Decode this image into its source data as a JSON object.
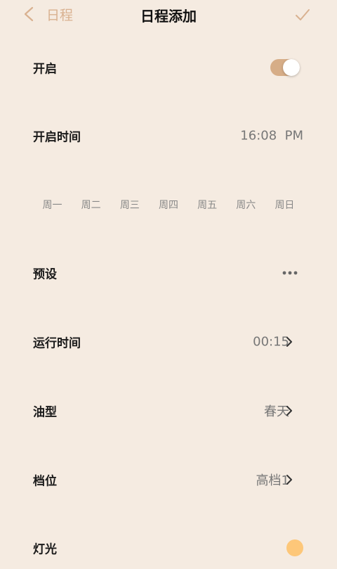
{
  "header": {
    "back_label": "日程",
    "title": "日程添加"
  },
  "rows": {
    "enable": {
      "label": "开启",
      "toggle_on": true
    },
    "start_time": {
      "label": "开启时间",
      "value": "16:08  PM"
    },
    "preset": {
      "label": "预设"
    },
    "run_time": {
      "label": "运行时间",
      "value": "00:15"
    },
    "oil_type": {
      "label": "油型",
      "value": "春天"
    },
    "gear": {
      "label": "档位",
      "value": "高档1"
    },
    "light": {
      "label": "灯光"
    }
  },
  "weekdays": [
    "周一",
    "周二",
    "周三",
    "周四",
    "周五",
    "周六",
    "周日"
  ],
  "colors": {
    "background": "#f5ebe1",
    "accent": "#d6ad87",
    "back_label": "#d9b190",
    "light_dot": "#fdc779"
  },
  "icons": {
    "back": "chevron-left-icon",
    "confirm": "checkmark-icon",
    "more": "more-horizontal-icon",
    "next": "chevron-right-icon"
  }
}
